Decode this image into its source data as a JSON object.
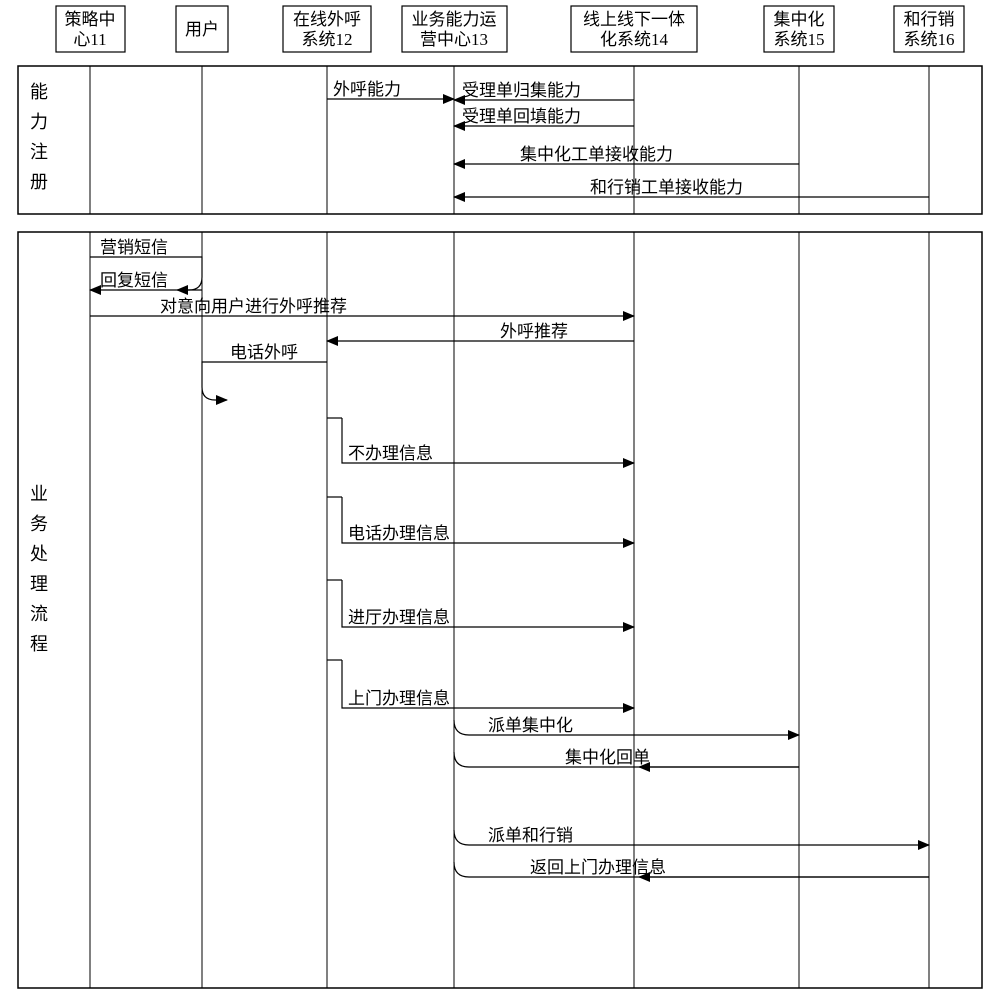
{
  "lifelines": {
    "policy": {
      "title1": "策略中",
      "title2": "心11"
    },
    "user": {
      "title1": "用户",
      "title2": ""
    },
    "call": {
      "title1": "在线外呼",
      "title2": "系统12"
    },
    "ops": {
      "title1": "业务能力运",
      "title2": "营中心13"
    },
    "o2o": {
      "title1": "线上线下一体",
      "title2": "化系统14"
    },
    "central": {
      "title1": "集中化",
      "title2": "系统15"
    },
    "hx": {
      "title1": "和行销",
      "title2": "系统16"
    }
  },
  "phases": {
    "reg": {
      "l1": "能",
      "l2": "力",
      "l3": "注",
      "l4": "册"
    },
    "proc": {
      "l1": "业",
      "l2": "务",
      "l3": "处",
      "l4": "理",
      "l5": "流",
      "l6": "程"
    }
  },
  "msgs": {
    "outcap": "外呼能力",
    "agg": "受理单归集能力",
    "fill": "受理单回填能力",
    "cenrecv": "集中化工单接收能力",
    "hxrecv": "和行销工单接收能力",
    "sms": "营销短信",
    "reply": "回复短信",
    "rec": "对意向用户进行外呼推荐",
    "outrec": "外呼推荐",
    "dial": "电话外呼",
    "noinfo": "不办理信息",
    "telinfo": "电话办理信息",
    "hallinfo": "进厅办理信息",
    "homeinfo": "上门办理信息",
    "dispcen": "派单集中化",
    "cenret": "集中化回单",
    "disphx": "派单和行销",
    "rethome": "返回上门办理信息"
  }
}
